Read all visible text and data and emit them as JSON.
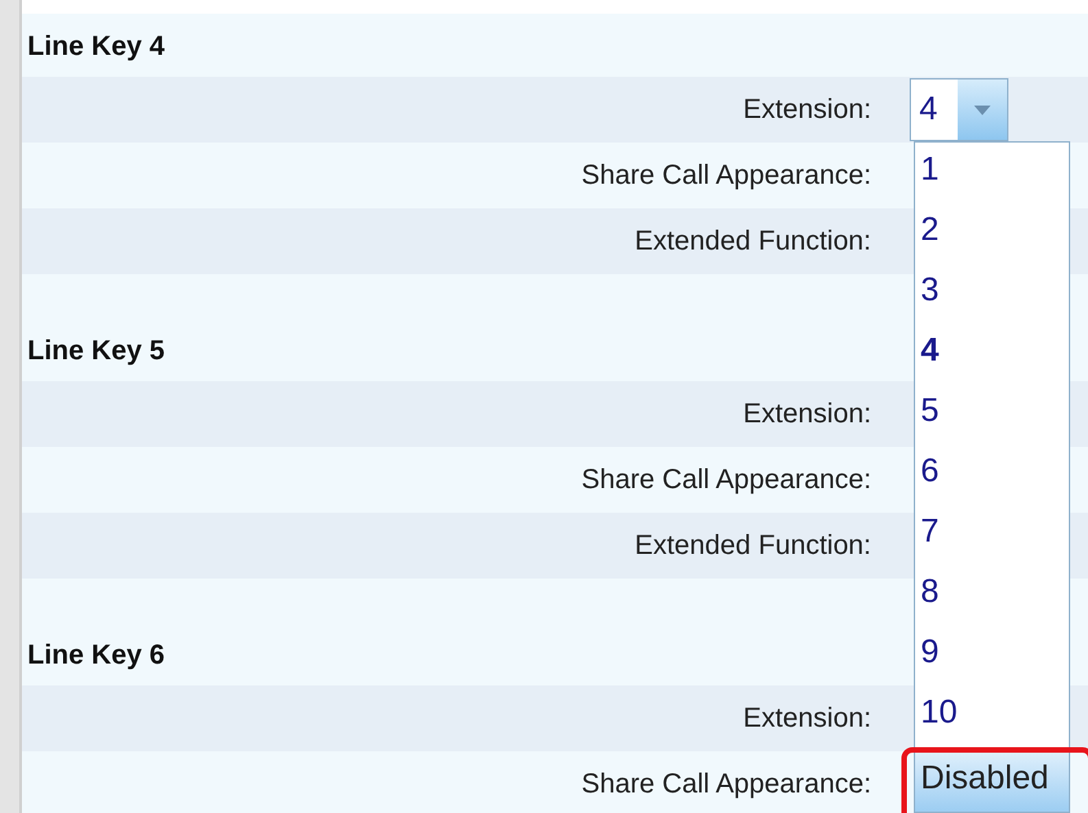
{
  "sections": [
    {
      "title": "Line Key 4",
      "fields": [
        {
          "label": "Extension:",
          "select": {
            "value": "4",
            "open": true
          }
        },
        {
          "label": "Share Call Appearance:"
        },
        {
          "label": "Extended Function:"
        }
      ]
    },
    {
      "title": "Line Key 5",
      "fields": [
        {
          "label": "Extension:"
        },
        {
          "label": "Share Call Appearance:"
        },
        {
          "label": "Extended Function:"
        }
      ]
    },
    {
      "title": "Line Key 6",
      "fields": [
        {
          "label": "Extension:"
        },
        {
          "label": "Share Call Appearance:"
        }
      ]
    }
  ],
  "dropdown_options": [
    {
      "label": "1",
      "selected": false,
      "highlighted": false
    },
    {
      "label": "2",
      "selected": false,
      "highlighted": false
    },
    {
      "label": "3",
      "selected": false,
      "highlighted": false
    },
    {
      "label": "4",
      "selected": true,
      "highlighted": false
    },
    {
      "label": "5",
      "selected": false,
      "highlighted": false
    },
    {
      "label": "6",
      "selected": false,
      "highlighted": false
    },
    {
      "label": "7",
      "selected": false,
      "highlighted": false
    },
    {
      "label": "8",
      "selected": false,
      "highlighted": false
    },
    {
      "label": "9",
      "selected": false,
      "highlighted": false
    },
    {
      "label": "10",
      "selected": false,
      "highlighted": false
    },
    {
      "label": "Disabled",
      "selected": false,
      "highlighted": true
    }
  ]
}
